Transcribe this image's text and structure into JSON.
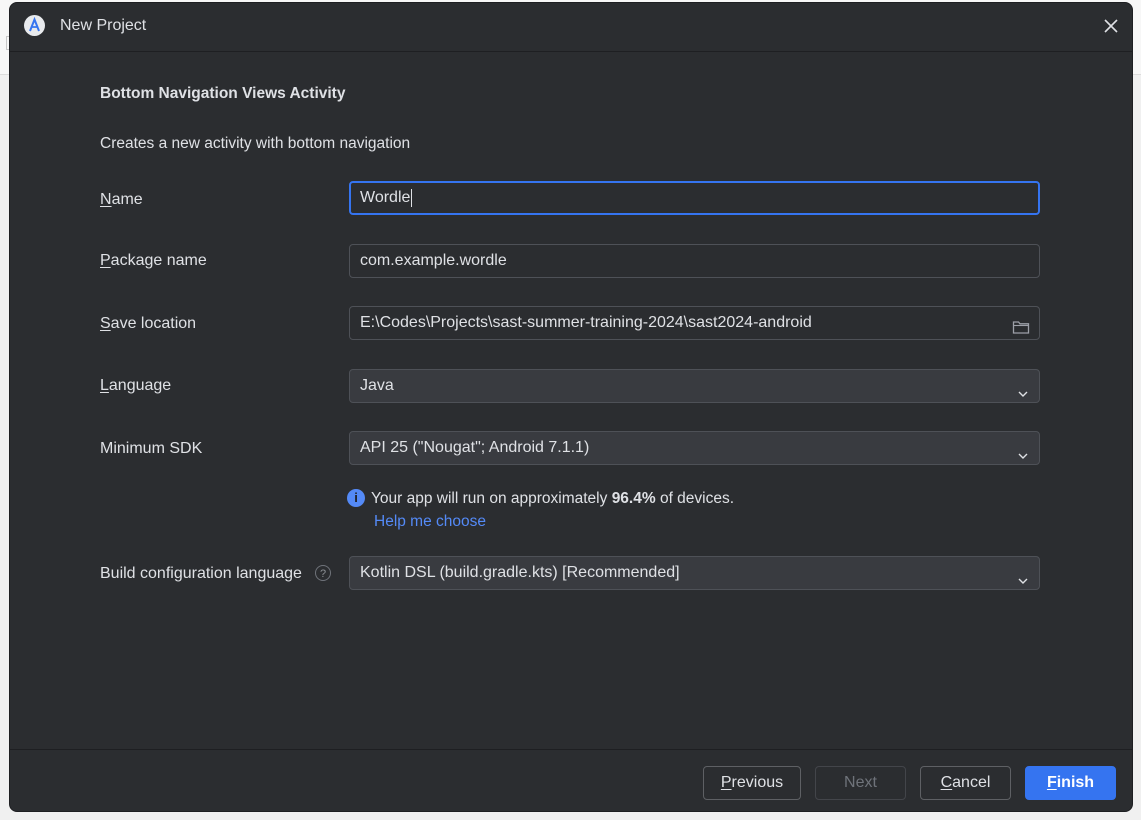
{
  "window": {
    "title": "New Project"
  },
  "template": {
    "heading": "Bottom Navigation Views Activity",
    "description": "Creates a new activity with bottom navigation"
  },
  "form": {
    "name": {
      "label_mnemonic": "N",
      "label_rest": "ame",
      "value": "Wordle"
    },
    "package_name": {
      "label_mnemonic": "P",
      "label_rest": "ackage name",
      "value": "com.example.wordle"
    },
    "save_location": {
      "label_mnemonic": "S",
      "label_rest": "ave location",
      "value": "E:\\Codes\\Projects\\sast-summer-training-2024\\sast2024-android",
      "icon": "folder-icon"
    },
    "language": {
      "label_mnemonic": "L",
      "label_rest": "anguage",
      "value": "Java"
    },
    "minimum_sdk": {
      "label": "Minimum SDK",
      "value": "API 25 (\"Nougat\"; Android 7.1.1)"
    },
    "sdk_info": {
      "text_before": "Your app will run on approximately ",
      "percent": "96.4%",
      "text_after": " of devices.",
      "help_link": "Help me choose"
    },
    "build_config": {
      "label": "Build configuration language",
      "value": "Kotlin DSL (build.gradle.kts) [Recommended]"
    }
  },
  "buttons": {
    "previous": {
      "mnemonic": "P",
      "rest": "revious"
    },
    "next": {
      "label": "Next"
    },
    "cancel": {
      "mnemonic": "C",
      "rest": "ancel"
    },
    "finish": {
      "mnemonic": "F",
      "rest": "inish"
    }
  },
  "colors": {
    "accent": "#3574f0",
    "link": "#548af7",
    "background": "#2b2d30"
  }
}
